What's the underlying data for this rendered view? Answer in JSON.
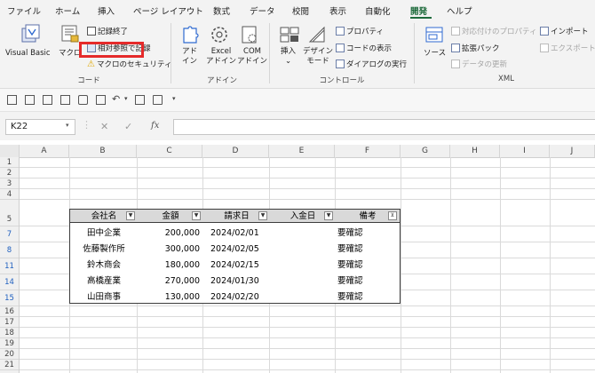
{
  "menu": {
    "items": [
      "ファイル",
      "ホーム",
      "挿入",
      "ページ レイアウト",
      "数式",
      "データ",
      "校閲",
      "表示",
      "自動化",
      "開発",
      "ヘルプ"
    ],
    "active_index": 9
  },
  "ribbon": {
    "code": {
      "visual_basic": "Visual Basic",
      "macro": "マクロ",
      "stop_recording": "記録終了",
      "relative_ref": "相対参照で記録",
      "macro_security": "マクロのセキュリティ",
      "group_label": "コード"
    },
    "addins": {
      "addin_line1": "アド",
      "addin_line2": "イン",
      "excel_line1": "Excel",
      "excel_line2": "アドイン",
      "com_line1": "COM",
      "com_line2": "アドイン",
      "group_label": "アドイン"
    },
    "controls": {
      "insert": "挿入",
      "design_line1": "デザイン",
      "design_line2": "モード",
      "properties": "プロパティ",
      "view_code": "コードの表示",
      "run_dialog": "ダイアログの実行",
      "group_label": "コントロール"
    },
    "xml": {
      "source": "ソース",
      "map_properties": "対応付けのプロパティ",
      "expansion_pack": "拡張パック",
      "refresh_data": "データの更新",
      "import": "インポート",
      "export": "エクスポート",
      "group_label": "XML"
    }
  },
  "formula_bar": {
    "name_box": "K22",
    "fx": "fx",
    "formula": ""
  },
  "grid": {
    "columns": [
      "A",
      "B",
      "C",
      "D",
      "E",
      "F",
      "G",
      "H",
      "I",
      "J"
    ],
    "rows": [
      "1",
      "2",
      "3",
      "4",
      "5",
      "7",
      "8",
      "11",
      "14",
      "15",
      "16",
      "17",
      "18",
      "19",
      "20",
      "21",
      "22",
      "23",
      "24",
      "25"
    ],
    "filtered_rows": [
      "7",
      "8",
      "11",
      "14",
      "15"
    ]
  },
  "table": {
    "headers": [
      "会社名",
      "金額",
      "請求日",
      "入金日",
      "備考"
    ],
    "rows": [
      {
        "company": "田中企業",
        "amount": "200,000",
        "date": "2024/02/01",
        "paid": "",
        "note": "要確認"
      },
      {
        "company": "佐藤製作所",
        "amount": "300,000",
        "date": "2024/02/05",
        "paid": "",
        "note": "要確認"
      },
      {
        "company": "鈴木商会",
        "amount": "180,000",
        "date": "2024/02/15",
        "paid": "",
        "note": "要確認"
      },
      {
        "company": "高橋産業",
        "amount": "270,000",
        "date": "2024/01/30",
        "paid": "",
        "note": "要確認"
      },
      {
        "company": "山田商事",
        "amount": "130,000",
        "date": "2024/02/20",
        "paid": "",
        "note": "要確認"
      }
    ]
  },
  "colors": {
    "accent": "#1e6b3c",
    "highlight": "#e52a2a",
    "table_header": "#d9d9d9"
  }
}
